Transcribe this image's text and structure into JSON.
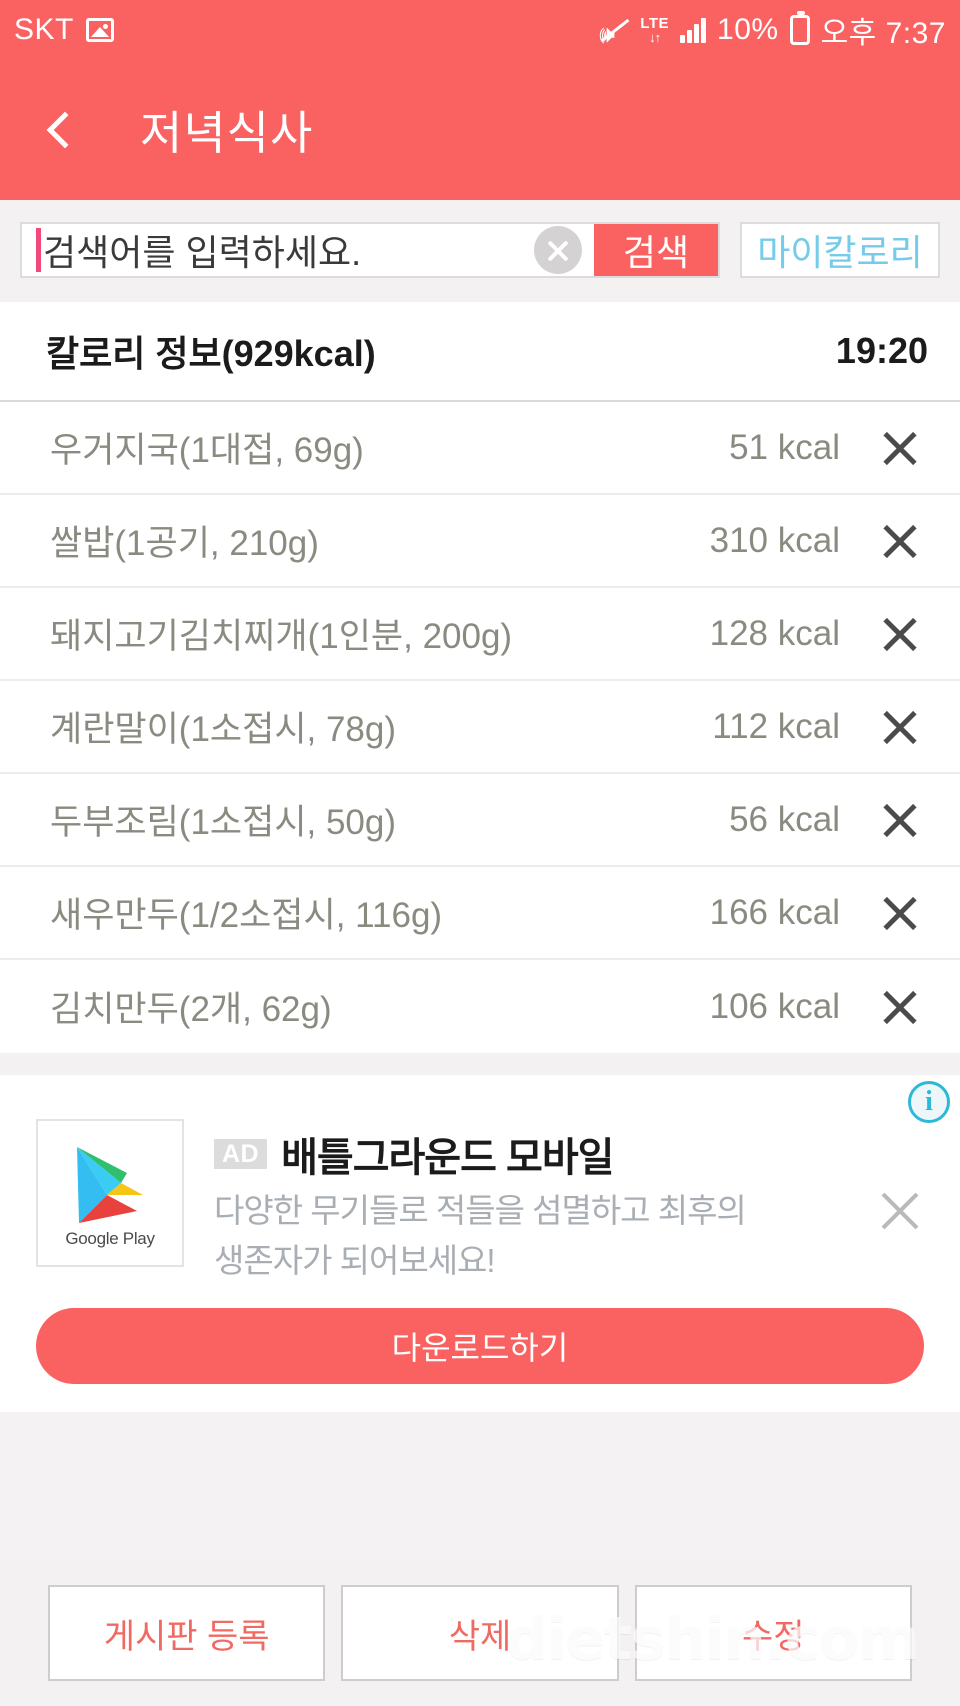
{
  "status_bar": {
    "carrier": "SKT",
    "gallery_icon": "image-icon",
    "mute_icon": "mute-icon",
    "network_label": "LTE",
    "network_sub": "↓↑",
    "signal_icon": "signal-bars-icon",
    "battery_percent": "10%",
    "battery_icon": "battery-charging-icon",
    "time": "오후 7:37"
  },
  "header": {
    "back_icon": "back-chevron-icon",
    "title": "저녁식사"
  },
  "search": {
    "placeholder": "검색어를 입력하세요.",
    "value": "",
    "clear_icon": "clear-circle-icon",
    "search_button": "검색",
    "mycalorie_button": "마이칼로리"
  },
  "calorie_header": {
    "title": "칼로리 정보(929kcal)",
    "total_kcal": "929kcal",
    "time": "19:20"
  },
  "food_items": [
    {
      "name": "우거지국(1대접, 69g)",
      "kcal": "51 kcal",
      "delete_icon": "close-x-icon"
    },
    {
      "name": "쌀밥(1공기, 210g)",
      "kcal": "310 kcal",
      "delete_icon": "close-x-icon"
    },
    {
      "name": "돼지고기김치찌개(1인분, 200g)",
      "kcal": "128 kcal",
      "delete_icon": "close-x-icon"
    },
    {
      "name": "계란말이(1소접시, 78g)",
      "kcal": "112 kcal",
      "delete_icon": "close-x-icon"
    },
    {
      "name": "두부조림(1소접시, 50g)",
      "kcal": "56 kcal",
      "delete_icon": "close-x-icon"
    },
    {
      "name": "새우만두(1/2소접시, 116g)",
      "kcal": "166 kcal",
      "delete_icon": "close-x-icon"
    },
    {
      "name": "김치만두(2개, 62g)",
      "kcal": "106 kcal",
      "delete_icon": "close-x-icon"
    }
  ],
  "ad": {
    "info_icon": "info-icon",
    "info_label": "i",
    "store_icon": "google-play-icon",
    "store_label": "Google Play",
    "badge": "AD",
    "title": "배틀그라운드 모바일",
    "description_line1": "다양한 무기들로 적들을 섬멸하고 최후의",
    "description_line2": "생존자가 되어보세요!",
    "close_icon": "close-x-icon",
    "cta": "다운로드하기"
  },
  "bottom_bar": {
    "buttons": [
      {
        "label": "게시판 등록"
      },
      {
        "label": "삭제"
      },
      {
        "label": "수정"
      }
    ]
  },
  "watermark": "dietshin.com",
  "colors": {
    "brand_red": "#fa6262",
    "link_blue": "#76cbe8",
    "action_red": "#f06a63",
    "page_bg": "#f4f1f3",
    "text_grey": "#8a8a80"
  }
}
